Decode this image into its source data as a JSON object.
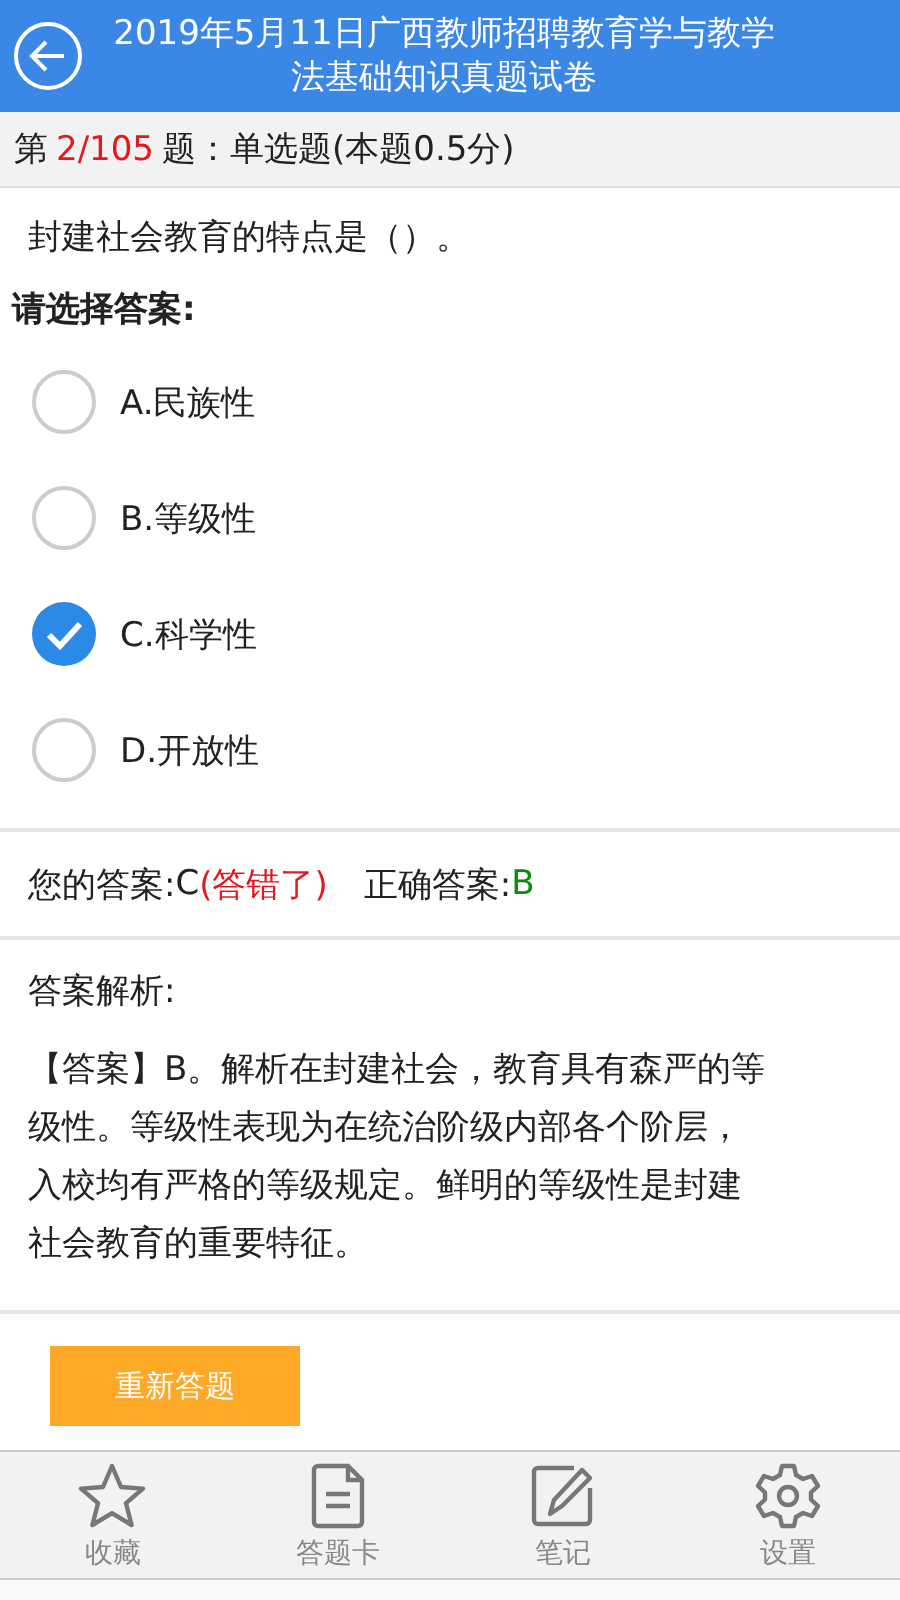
{
  "header": {
    "title": "2019年5月11日广西教师招聘教育学与教学法基础知识真题试卷"
  },
  "question_bar": {
    "prefix": "第",
    "number": "2/105",
    "suffix": "题：单选题(本题0.5分)"
  },
  "question": "封建社会教育的特点是（）。",
  "prompt": "请选择答案:",
  "options": [
    {
      "label": "A.民族性",
      "selected": false
    },
    {
      "label": "B.等级性",
      "selected": false
    },
    {
      "label": "C.科学性",
      "selected": true
    },
    {
      "label": "D.开放性",
      "selected": false
    }
  ],
  "result": {
    "your_label": "您的答案:",
    "your_value": "C",
    "verdict": "(答错了)",
    "correct_label": "正确答案:",
    "correct_value": "B"
  },
  "analysis": {
    "title": "答案解析:",
    "text": "【答案】B。解析在封建社会，教育具有森严的等级性。等级性表现为在统治阶级内部各个阶层，入校均有严格的等级规定。鲜明的等级性是封建社会教育的重要特征。"
  },
  "retry_button": "重新答题",
  "bottom_bar": [
    {
      "kind": "star",
      "label": "收藏"
    },
    {
      "kind": "card",
      "label": "答题卡"
    },
    {
      "kind": "note",
      "label": "笔记"
    },
    {
      "kind": "gear",
      "label": "设置"
    }
  ]
}
